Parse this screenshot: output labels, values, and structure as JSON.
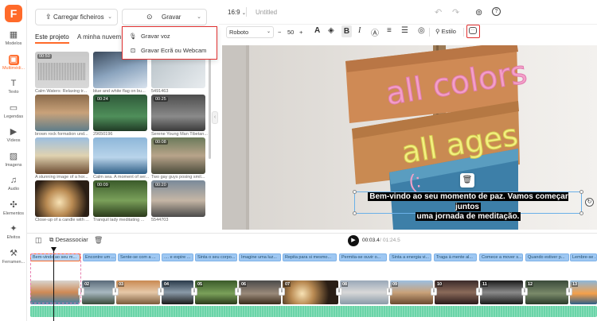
{
  "app": {
    "logo": "F",
    "project_title": "Untitled",
    "aspect_ratio": "16:9"
  },
  "nav": [
    {
      "label": "Modelos",
      "icon": "grid-icon"
    },
    {
      "label": "Multimédi...",
      "icon": "media-icon",
      "active": true
    },
    {
      "label": "Texto",
      "icon": "text-icon"
    },
    {
      "label": "Legendas",
      "icon": "captions-icon"
    },
    {
      "label": "Vídeos",
      "icon": "video-icon"
    },
    {
      "label": "Imagens",
      "icon": "image-icon"
    },
    {
      "label": "Áudio",
      "icon": "audio-icon"
    },
    {
      "label": "Elementos",
      "icon": "elements-icon"
    },
    {
      "label": "Efeitos",
      "icon": "effects-icon"
    },
    {
      "label": "Ferramen...",
      "icon": "tools-icon"
    }
  ],
  "panel": {
    "upload_label": "Carregar ficheiros",
    "record_label": "Gravar",
    "tabs": [
      "Este projeto",
      "A minha nuvem"
    ],
    "media": [
      {
        "label": "Calm Waters: Relaxing tr...",
        "duration": "00:50"
      },
      {
        "label": "blue and white flag on bu...",
        "duration": ""
      },
      {
        "label": "5491463",
        "duration": ""
      },
      {
        "label": "brown rock formation und...",
        "duration": ""
      },
      {
        "label": "29650196",
        "duration": "00:24"
      },
      {
        "label": "Serene Young Man Tibetan...",
        "duration": "00:25"
      },
      {
        "label": "A stunning image of a hor...",
        "duration": ""
      },
      {
        "label": "Calm sea. A moment of ser...",
        "duration": ""
      },
      {
        "label": "Two gay guys posing smil...",
        "duration": "00:08"
      },
      {
        "label": "Close-up of a candle with ...",
        "duration": ""
      },
      {
        "label": "Tranquil lady meditating ...",
        "duration": "00:09"
      },
      {
        "label": "5544703",
        "duration": "00:20"
      }
    ]
  },
  "record_menu": {
    "items": [
      {
        "label": "Gravar voz",
        "icon": "microphone-icon"
      },
      {
        "label": "Gravar Ecrã ou Webcam",
        "icon": "screen-record-icon"
      }
    ]
  },
  "format": {
    "font": "Roboto",
    "size": "50",
    "style_label": "Estilo"
  },
  "canvas": {
    "sign1": "all colors",
    "sign2": "all ages",
    "sign3": "(:",
    "caption_line1": "Bem-vindo ao seu momento de paz. Vamos começar juntos",
    "caption_line2": "uma jornada de meditação."
  },
  "timeline": {
    "detach_label": "Desassociar",
    "current_time": "00:03.4",
    "total_time": "01:24.5",
    "captions": [
      "Bem-vindo ao seu m...",
      "Encontre um ...",
      "Sente-se com a ...",
      ".... e expire ...",
      "Sinta o seu corpo...",
      "Imagine uma luz...",
      "Repita para si mesmo...",
      "Permita-se ouvir o...",
      "Sinta a energia vi...",
      "Traga à mente al...",
      "Comece a mover s...",
      "Quando estiver p...",
      "Lembre-se ..."
    ],
    "clips": [
      "",
      "02",
      "03",
      "04",
      "05",
      "06",
      "07",
      "08",
      "09",
      "10",
      "11",
      "12",
      "13"
    ]
  },
  "colors": {
    "accent": "#ff6a2a",
    "caption_blue": "#9ec7f2",
    "audio_green": "#6ad4a8",
    "highlight_red": "#e03030"
  }
}
